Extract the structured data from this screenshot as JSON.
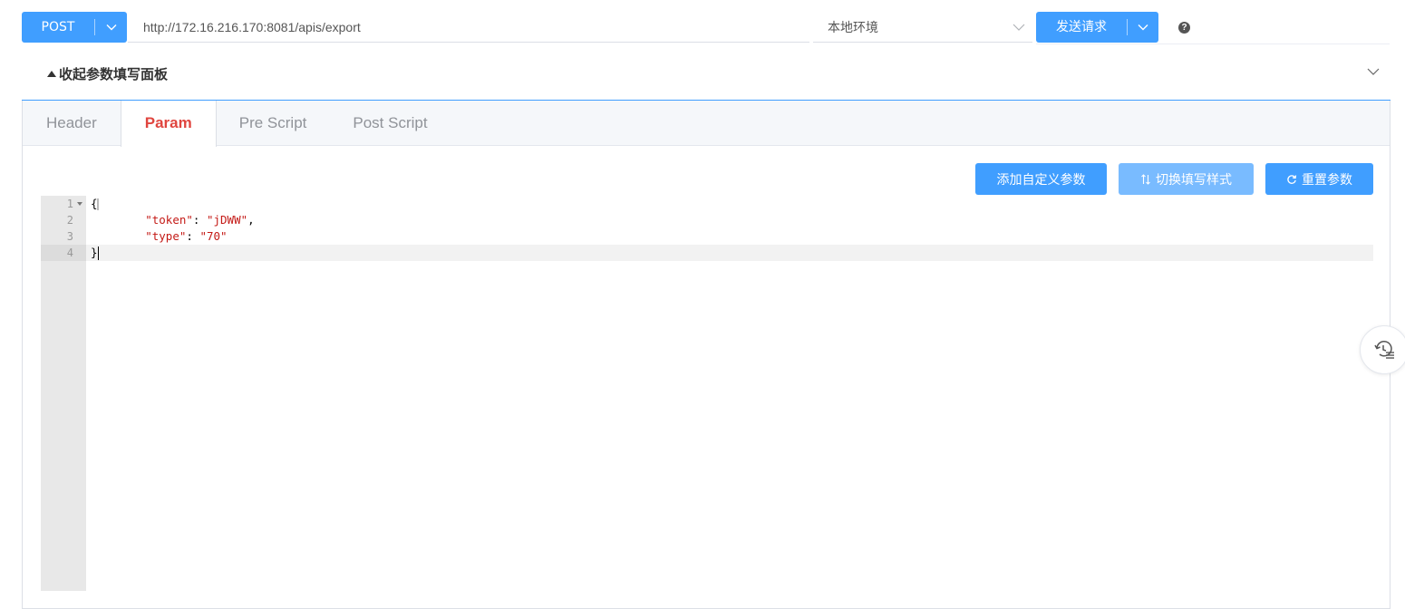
{
  "request": {
    "method": "POST",
    "url": "http://172.16.216.170:8081/apis/export",
    "environment": "本地环境",
    "send_label": "发送请求"
  },
  "panel": {
    "collapse_title": "收起参数填写面板"
  },
  "tabs": [
    {
      "label": "Header",
      "active": false
    },
    {
      "label": "Param",
      "active": true
    },
    {
      "label": "Pre Script",
      "active": false
    },
    {
      "label": "Post Script",
      "active": false
    }
  ],
  "actions": {
    "add_custom_param": "添加自定义参数",
    "switch_fill_style": "切换填写样式",
    "reset_params": "重置参数"
  },
  "editor": {
    "line_numbers": [
      "1",
      "2",
      "3",
      "4"
    ],
    "lines": {
      "l1": "{",
      "token_key": "\"token\"",
      "token_val": "\"jDWW\"",
      "type_key": "\"type\"",
      "type_val": "\"70\"",
      "l4": "}"
    }
  },
  "colors": {
    "primary": "#409eff",
    "primary_light": "#79bbff",
    "active_tab": "#e0453f",
    "string": "#c41a16"
  },
  "icons": [
    "chevron-down-icon",
    "help-icon",
    "triangle-up-icon",
    "sort-icon",
    "refresh-icon",
    "history-icon"
  ]
}
